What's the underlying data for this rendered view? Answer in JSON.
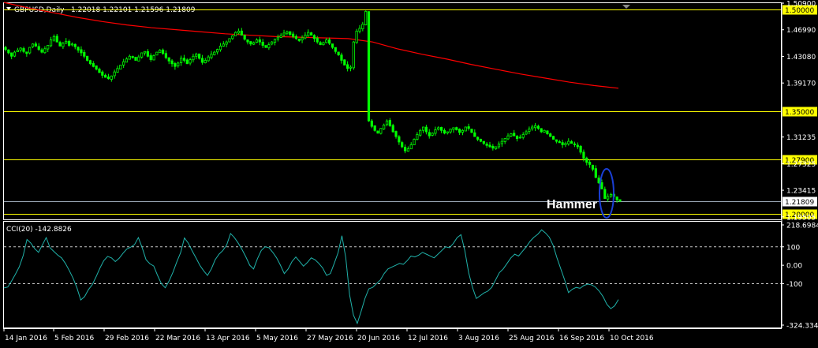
{
  "header": {
    "symbol": "GBPUSD,Daily",
    "ohlc": "1.22018 1.22101 1.21596 1.21809"
  },
  "indicator": {
    "label": "CCI(20) -142.8826"
  },
  "annotation": {
    "text": "Hammer"
  },
  "colors": {
    "background": "#000000",
    "candles": "#00ff00",
    "moving_average": "#ff0000",
    "levels": "#ffff00",
    "cci": "#20b2aa",
    "highlight_ellipse": "#1a3fd6"
  },
  "chart_data": [
    {
      "type": "candlestick",
      "symbol": "GBPUSD",
      "timeframe": "Daily",
      "ylim": [
        1.1925,
        1.509
      ],
      "price_labels": [
        "1.50900",
        "1.46990",
        "1.43080",
        "1.39170",
        "1.31235",
        "1.27325",
        "1.23415",
        "1.19505"
      ],
      "price_label_values": [
        1.509,
        1.4699,
        1.4308,
        1.3917,
        1.31235,
        1.27325,
        1.23415,
        1.19505
      ],
      "x_labels": [
        "14 Jan 2016",
        "5 Feb 2016",
        "29 Feb 2016",
        "22 Mar 2016",
        "13 Apr 2016",
        "5 May 2016",
        "27 May 2016",
        "20 Jun 2016",
        "12 Jul 2016",
        "3 Aug 2016",
        "25 Aug 2016",
        "16 Sep 2016",
        "10 Oct 2016"
      ],
      "horizontal_levels": [
        {
          "value": 1.5,
          "label": "1.50000"
        },
        {
          "value": 1.35,
          "label": "1.35000"
        },
        {
          "value": 1.279,
          "label": "1.27900"
        },
        {
          "value": 1.21809,
          "label": "1.21809",
          "type": "current_price"
        },
        {
          "value": 1.2,
          "label": "1.20000"
        }
      ],
      "close_path": [
        1.441,
        1.436,
        1.431,
        1.437,
        1.44,
        1.443,
        1.438,
        1.435,
        1.444,
        1.449,
        1.446,
        1.441,
        1.437,
        1.442,
        1.447,
        1.455,
        1.46,
        1.452,
        1.446,
        1.45,
        1.453,
        1.447,
        1.449,
        1.445,
        1.44,
        1.436,
        1.431,
        1.425,
        1.42,
        1.416,
        1.412,
        1.407,
        1.403,
        1.4,
        1.398,
        1.402,
        1.408,
        1.413,
        1.418,
        1.423,
        1.427,
        1.431,
        1.429,
        1.425,
        1.43,
        1.436,
        1.438,
        1.431,
        1.426,
        1.432,
        1.437,
        1.44,
        1.435,
        1.429,
        1.424,
        1.42,
        1.416,
        1.421,
        1.428,
        1.425,
        1.42,
        1.426,
        1.431,
        1.434,
        1.428,
        1.422,
        1.425,
        1.43,
        1.434,
        1.437,
        1.441,
        1.446,
        1.449,
        1.452,
        1.457,
        1.461,
        1.466,
        1.468,
        1.462,
        1.456,
        1.452,
        1.449,
        1.451,
        1.455,
        1.452,
        1.447,
        1.444,
        1.448,
        1.452,
        1.456,
        1.459,
        1.462,
        1.465,
        1.467,
        1.463,
        1.46,
        1.457,
        1.454,
        1.458,
        1.462,
        1.466,
        1.462,
        1.457,
        1.452,
        1.448,
        1.451,
        1.455,
        1.45,
        1.444,
        1.438,
        1.433,
        1.425,
        1.418,
        1.413,
        1.415,
        1.452,
        1.468,
        1.472,
        1.478,
        1.497,
        1.336,
        1.328,
        1.322,
        1.318,
        1.325,
        1.33,
        1.336,
        1.329,
        1.32,
        1.313,
        1.305,
        1.298,
        1.292,
        1.295,
        1.301,
        1.309,
        1.316,
        1.322,
        1.327,
        1.32,
        1.314,
        1.318,
        1.323,
        1.326,
        1.322,
        1.318,
        1.32,
        1.324,
        1.326,
        1.323,
        1.319,
        1.322,
        1.327,
        1.325,
        1.319,
        1.313,
        1.309,
        1.306,
        1.303,
        1.3,
        1.298,
        1.296,
        1.298,
        1.302,
        1.306,
        1.31,
        1.314,
        1.317,
        1.314,
        1.31,
        1.312,
        1.316,
        1.32,
        1.324,
        1.327,
        1.329,
        1.325,
        1.32,
        1.322,
        1.317,
        1.313,
        1.309,
        1.306,
        1.304,
        1.301,
        1.303,
        1.306,
        1.303,
        1.301,
        1.298,
        1.29,
        1.281,
        1.275,
        1.272,
        1.265,
        1.253,
        1.245,
        1.236,
        1.222,
        1.225,
        1.228,
        1.225,
        1.22,
        1.218
      ],
      "moving_average": {
        "color": "#ff0000",
        "values": [
          1.51,
          1.502,
          1.495,
          1.488,
          1.482,
          1.477,
          1.473,
          1.47,
          1.467,
          1.464,
          1.462,
          1.46,
          1.459,
          1.458,
          1.457,
          1.452,
          1.442,
          1.434,
          1.427,
          1.419,
          1.412,
          1.405,
          1.399,
          1.393,
          1.388,
          1.384
        ]
      }
    },
    {
      "type": "line",
      "name": "CCI(20)",
      "ylim": [
        -324.3348,
        218.6984
      ],
      "tick_labels": [
        "218.6984",
        "100",
        "0.00",
        "-100",
        "-324.3348"
      ],
      "reference_levels": [
        100,
        -100
      ],
      "values": [
        -123,
        -118,
        -85,
        -48,
        -8,
        52,
        140,
        120,
        90,
        70,
        110,
        150,
        95,
        75,
        55,
        40,
        10,
        -28,
        -70,
        -122,
        -188,
        -170,
        -132,
        -105,
        -62,
        -15,
        25,
        48,
        40,
        20,
        38,
        65,
        88,
        98,
        112,
        150,
        95,
        30,
        8,
        -4,
        -55,
        -100,
        -122,
        -85,
        -38,
        18,
        68,
        148,
        120,
        78,
        40,
        0,
        -30,
        -55,
        -20,
        30,
        60,
        80,
        110,
        172,
        150,
        120,
        85,
        45,
        0,
        -20,
        35,
        80,
        100,
        95,
        70,
        40,
        0,
        -45,
        -20,
        20,
        45,
        20,
        -5,
        15,
        40,
        30,
        10,
        -15,
        -55,
        -45,
        10,
        68,
        160,
        42,
        -160,
        -270,
        -315,
        -250,
        -180,
        -128,
        -120,
        -100,
        -80,
        -45,
        -20,
        -10,
        0,
        10,
        5,
        25,
        50,
        45,
        55,
        70,
        60,
        50,
        40,
        60,
        80,
        100,
        95,
        118,
        150,
        166,
        80,
        -40,
        -120,
        -180,
        -165,
        -150,
        -140,
        -120,
        -80,
        -40,
        -20,
        10,
        40,
        60,
        50,
        75,
        100,
        130,
        152,
        168,
        192,
        175,
        152,
        108,
        40,
        -20,
        -80,
        -148,
        -130,
        -120,
        -125,
        -110,
        -102,
        -106,
        -118,
        -140,
        -170,
        -212,
        -235,
        -220,
        -186
      ]
    }
  ]
}
